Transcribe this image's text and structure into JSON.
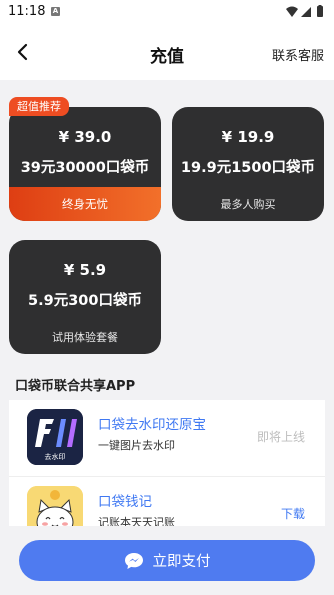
{
  "status_bar": {
    "time": "11:18",
    "notification_letter": "A"
  },
  "nav": {
    "title": "充值",
    "contact": "联系客服",
    "back_icon": "chevron-left-icon"
  },
  "packages": [
    {
      "price": "¥ 39.0",
      "name": "39元30000口袋币",
      "tag": "终身无忧",
      "badge": "超值推荐",
      "highlight": true
    },
    {
      "price": "¥ 19.9",
      "name": "19.9元1500口袋币",
      "tag": "最多人购买",
      "highlight": false
    },
    {
      "price": "¥ 5.9",
      "name": "5.9元300口袋币",
      "tag": "试用体验套餐",
      "highlight": false
    }
  ],
  "section_title": "口袋币联合共享APP",
  "apps": [
    {
      "name": "口袋去水印还原宝",
      "desc": "一键图片去水印",
      "action": "即将上线",
      "icon_label": "去水印",
      "icon": "watermark-remover-icon"
    },
    {
      "name": "口袋钱记",
      "desc": "记账本天天记账",
      "action": "下载",
      "icon": "cat-face-icon"
    }
  ],
  "pay_button": {
    "label": "立即支付",
    "icon": "chat-bubble-icon"
  },
  "colors": {
    "accent_blue": "#4f7bf0",
    "link_blue": "#3f78f2",
    "card_dark": "#2f2f30",
    "badge_orange": "#ee4d22"
  }
}
